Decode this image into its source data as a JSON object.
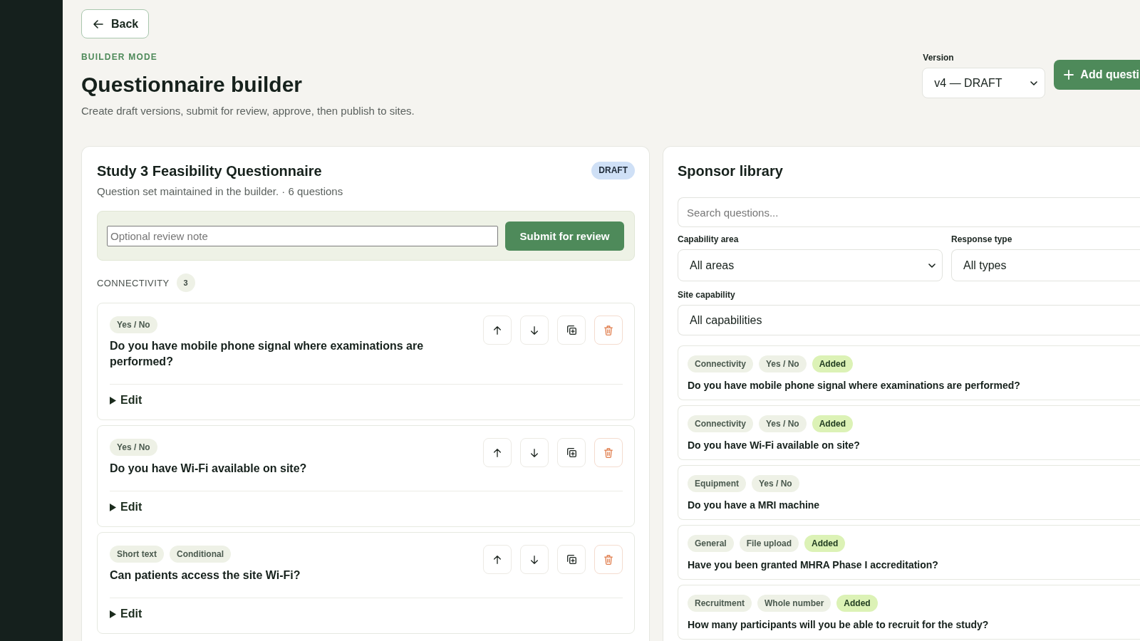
{
  "back_button": {
    "label": "Back"
  },
  "header": {
    "eyebrow": "BUILDER MODE",
    "title": "Questionnaire builder",
    "subtitle": "Create draft versions, submit for review, approve, then publish to sites."
  },
  "version": {
    "label": "Version",
    "value": "v4 — DRAFT"
  },
  "add_button": {
    "label": "Add questi"
  },
  "questionnaire": {
    "title": "Study 3 Feasibility Questionnaire",
    "status": "DRAFT",
    "subtitle": "Question set maintained in the builder. · 6 questions",
    "review_note": {
      "placeholder": "Optional review note"
    },
    "submit_button": "Submit for review",
    "sections": [
      {
        "name": "CONNECTIVITY",
        "count": "3",
        "questions": [
          {
            "tags": [
              "Yes / No"
            ],
            "text": "Do you have mobile phone signal where examinations are performed?",
            "edit_label": "Edit",
            "expanded": false
          },
          {
            "tags": [
              "Yes / No"
            ],
            "text": "Do you have Wi-Fi available on site?",
            "edit_label": "Edit",
            "expanded": false
          },
          {
            "tags": [
              "Short text",
              "Conditional"
            ],
            "text": "Can patients access the site Wi-Fi?",
            "edit_label": "Edit",
            "expanded": false
          }
        ]
      }
    ]
  },
  "library": {
    "title": "Sponsor library",
    "search": {
      "placeholder": "Search questions..."
    },
    "filters": [
      {
        "label": "Capability area",
        "value": "All areas"
      },
      {
        "label": "Response type",
        "value": "All types"
      }
    ],
    "site_capability": {
      "label": "Site capability",
      "value": "All capabilities"
    },
    "items": [
      {
        "tags": [
          {
            "label": "Connectivity",
            "kind": "area"
          },
          {
            "label": "Yes / No",
            "kind": "type"
          },
          {
            "label": "Added",
            "kind": "status"
          }
        ],
        "text": "Do you have mobile phone signal where examinations are performed?"
      },
      {
        "tags": [
          {
            "label": "Connectivity",
            "kind": "area"
          },
          {
            "label": "Yes / No",
            "kind": "type"
          },
          {
            "label": "Added",
            "kind": "status"
          }
        ],
        "text": "Do you have Wi-Fi available on site?"
      },
      {
        "tags": [
          {
            "label": "Equipment",
            "kind": "area"
          },
          {
            "label": "Yes / No",
            "kind": "type"
          }
        ],
        "text": "Do you have a MRI machine"
      },
      {
        "tags": [
          {
            "label": "General",
            "kind": "area"
          },
          {
            "label": "File upload",
            "kind": "type"
          },
          {
            "label": "Added",
            "kind": "status"
          }
        ],
        "text": "Have you been granted MHRA Phase I accreditation?"
      },
      {
        "tags": [
          {
            "label": "Recruitment",
            "kind": "area"
          },
          {
            "label": "Whole number",
            "kind": "type"
          },
          {
            "label": "Added",
            "kind": "status"
          }
        ],
        "text": "How many participants will you be able to recruit for the study?"
      }
    ]
  }
}
